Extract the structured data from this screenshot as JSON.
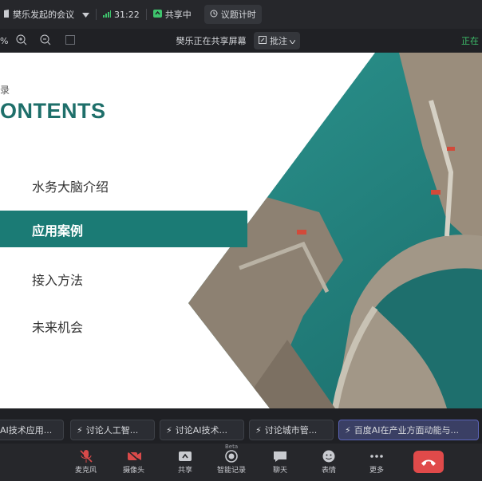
{
  "meeting": {
    "title": "樊乐发起的会议",
    "timer": "31:22",
    "sharing_badge": "共享中",
    "agenda_timer": "议题计时"
  },
  "toolbar": {
    "zoom_text": "%",
    "share_status": "樊乐正在共享屏幕",
    "annotate_label": "批注",
    "right_status": "正在"
  },
  "slide": {
    "small_char": "录",
    "heading": "ONTENTS",
    "items": [
      {
        "label": "水务大脑介绍",
        "active": false
      },
      {
        "label": "应用案例",
        "active": true
      },
      {
        "label": "接入方法",
        "active": false
      },
      {
        "label": "未来机会",
        "active": false
      }
    ],
    "colors": {
      "accent": "#1b7b75",
      "heading": "#1e6f6a"
    }
  },
  "agenda": [
    {
      "label": "AI技术应用...",
      "active": false
    },
    {
      "label": "讨论人工智...",
      "active": false
    },
    {
      "label": "讨论AI技术...",
      "active": false
    },
    {
      "label": "讨论城市管...",
      "active": false
    },
    {
      "label": "百度AI在产业方面动能与...",
      "active": true
    }
  ],
  "controls": {
    "mic": "麦克风",
    "camera": "摄像头",
    "share": "共享",
    "record": "智能记录",
    "record_badge": "Beta",
    "chat": "聊天",
    "emoji": "表情",
    "more": "更多"
  },
  "icons": [
    "shield-icon",
    "chevron-down-icon",
    "signal-icon",
    "share-screen-icon",
    "clock-icon",
    "zoom-in-icon",
    "zoom-out-icon",
    "grid-icon",
    "annotate-icon",
    "mic-off-icon",
    "camera-off-icon",
    "record-icon",
    "chat-icon",
    "emoji-icon",
    "more-icon",
    "end-call-icon"
  ]
}
